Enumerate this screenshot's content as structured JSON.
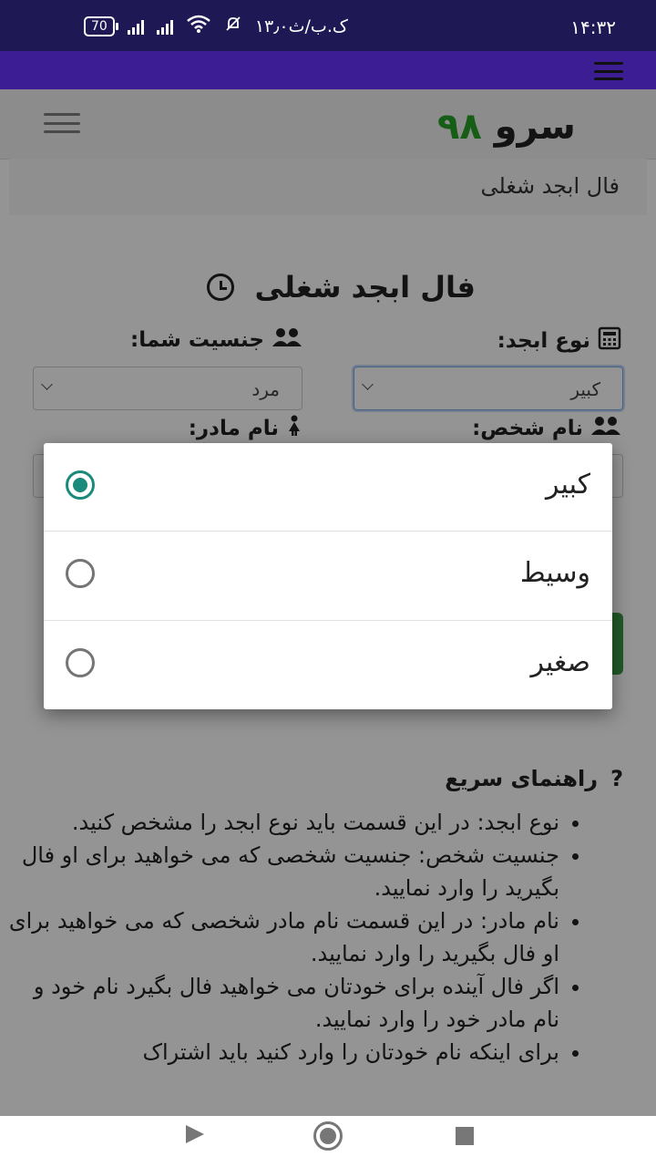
{
  "status_bar": {
    "time": "۱۴:۳۲",
    "network_speed": "۱۳٫۰ک.ب/ث",
    "battery": "70"
  },
  "site": {
    "logo_word": "سرو",
    "logo_number": "۹۸",
    "breadcrumb": "فال ابجد شغلی"
  },
  "form": {
    "title": "فال ابجد شغلی",
    "abjad_type_label": "نوع ابجد:",
    "abjad_type_value": "کبیر",
    "gender_label": "جنسیت شما:",
    "gender_value": "مرد",
    "person_name_label": "نام شخص:",
    "mother_name_label": "نام مادر:"
  },
  "help": {
    "title": "راهنمای سریع",
    "items": [
      "نوع ابجد: در این قسمت باید نوع ابجد را مشخص کنید.",
      "جنسیت شخص: جنسیت شخصی که می خواهید برای او فال بگیرید را وارد نمایید.",
      "نام مادر: در این قسمت نام مادر شخصی که می خواهید برای او فال بگیرید را وارد نمایید.",
      "اگر فال آینده برای خودتان می خواهید فال بگیرد نام خود و نام مادر خود را وارد نمایید.",
      "برای اینکه نام خودتان را وارد کنید باید اشتراک"
    ]
  },
  "picker": {
    "options": [
      {
        "label": "کبیر",
        "checked": true
      },
      {
        "label": "وسیط",
        "checked": false
      },
      {
        "label": "صغیر",
        "checked": false
      }
    ],
    "accent_color": "#1a8a7c"
  }
}
